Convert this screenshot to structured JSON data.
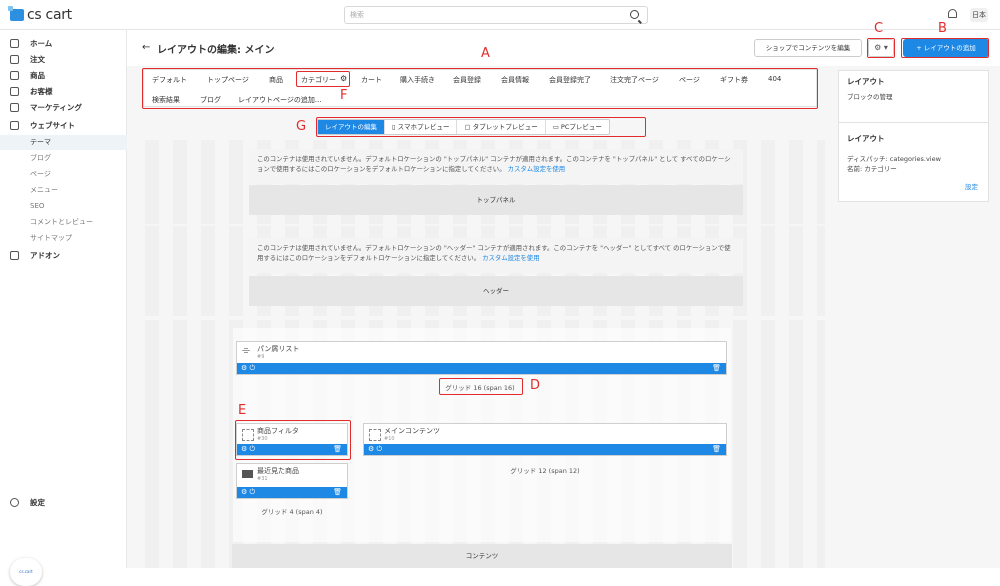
{
  "header": {
    "logo": "cs cart",
    "search_placeholder": "検索",
    "language": "日本"
  },
  "sidebar": {
    "items": [
      {
        "label": "ホーム",
        "icon": "home-icon"
      },
      {
        "label": "注文",
        "icon": "orders-icon"
      },
      {
        "label": "商品",
        "icon": "tag-icon"
      },
      {
        "label": "お客様",
        "icon": "user-icon"
      },
      {
        "label": "マーケティング",
        "icon": "megaphone-icon"
      },
      {
        "label": "ウェブサイト",
        "icon": "monitor-icon"
      }
    ],
    "website_sub": [
      "テーマ",
      "ブログ",
      "ページ",
      "メニュー",
      "SEO",
      "コメントとレビュー",
      "サイトマップ"
    ],
    "addons": "アドオン",
    "settings": "設定",
    "avatar_text": "cs.cart"
  },
  "page": {
    "title": "レイアウトの編集: メイン",
    "shop_button": "ショップでコンテンツを編集",
    "add_button": "+ レイアウトの追加"
  },
  "layout_tabs": [
    "デフォルト",
    "トップページ",
    "商品",
    "カテゴリー",
    "カート",
    "購入手続き",
    "会員登録",
    "会員情報",
    "会員登録完了",
    "注文完了ページ",
    "ページ",
    "ギフト券",
    "404",
    "検索結果",
    "ブログ",
    "レイアウトページの追加..."
  ],
  "preview_tabs": [
    "レイアウトの編集",
    "スマホプレビュー",
    "タブレットプレビュー",
    "PCプレビュー"
  ],
  "sections": {
    "top_panel_notice": "このコンテナは使用されていません。デフォルトロケーションの \"トップパネル\" コンテナが適用されます。このコンテナを \"トップパネル\" として すべてのロケーションで使用するにはこのロケーションをデフォルトロケーションに指定してください。",
    "top_panel_link": "カスタム設定を使用",
    "top_panel_label": "トップパネル",
    "header_notice": "このコンテナは使用されていません。デフォルトロケーションの \"ヘッダー\" コンテナが適用されます。このコンテナを \"ヘッダー\" としてすべて のロケーションで使用するにはこのロケーションをデフォルトロケーションに指定してください。",
    "header_link": "カスタム設定を使用",
    "header_label": "ヘッダー",
    "content_label": "コンテンツ"
  },
  "blocks": {
    "breadcrumb": {
      "name": "パン屑リスト",
      "id": "#9"
    },
    "grid16": "グリッド 16 (span 16)",
    "filter": {
      "name": "商品フィルタ",
      "id": "#30"
    },
    "recent": {
      "name": "最近見た商品",
      "id": "#31"
    },
    "grid4": "グリッド 4 (span 4)",
    "main_content": {
      "name": "メインコンテンツ",
      "id": "#10"
    },
    "grid12": "グリッド 12 (span 12)"
  },
  "right_panel": {
    "layout_title": "レイアウト",
    "block_manage": "ブロックの管理",
    "layout2_title": "レイアウト",
    "dispatch": "ディスパッチ: categories.view",
    "name": "名前: カテゴリー",
    "settings_link": "設定"
  },
  "annotations": [
    "A",
    "B",
    "C",
    "D",
    "E",
    "F",
    "G"
  ],
  "colors": {
    "accent": "#1e88e5",
    "annotation": "#e32b2b"
  }
}
